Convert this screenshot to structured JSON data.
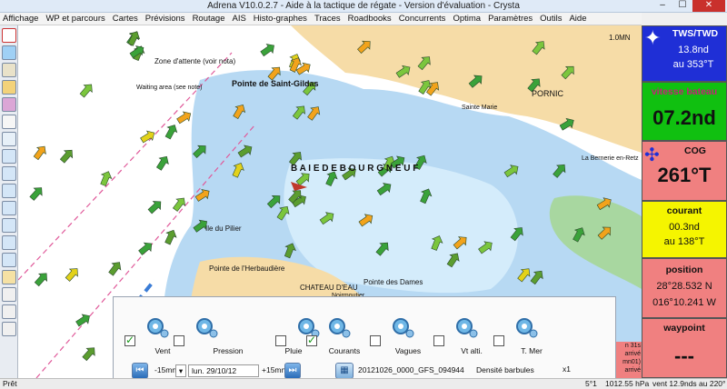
{
  "window": {
    "title": "Adrena V10.0.2.7 - Aide à la tactique de régate - Version d'évaluation - Crysta"
  },
  "menu": [
    "Affichage",
    "WP et parcours",
    "Cartes",
    "Prévisions",
    "Routage",
    "AIS",
    "Histo-graphes",
    "Traces",
    "Roadbooks",
    "Concurrents",
    "Optima",
    "Paramètres",
    "Outils",
    "Aide"
  ],
  "map": {
    "scale_label": "1.0MN",
    "labels": {
      "pointe_st_gildas": "Pointe de Saint-Gildas",
      "pornic": "PORNIC",
      "banc_bourgneuf": "B A I E   D E   B O U R G N E U F",
      "ile_pilier": "Ile du Pilier",
      "pointe_herbaudiere": "Pointe de l'Herbaudière",
      "chateau_eau": "CHATEAU D'EAU",
      "noirmoutier": "Noirmoutier",
      "pointe_dames": "Pointe des Dames",
      "zone_attente": "Zone d'attente (voir nota)",
      "waiting_area": "Waiting area (see note)",
      "la_bernerie": "La Bernerie en-Retz",
      "sainte_marie": "Sainte Marie"
    }
  },
  "panel": {
    "tws_label": "TWS/TWD",
    "tws_value": "13.8nd",
    "twd_value": "au 353°T",
    "speed_label": "vitesse bateau",
    "speed_value": "07.2nd",
    "cog_label": "COG",
    "cog_value": "261°T",
    "current_label": "courant",
    "current_speed": "00.3nd",
    "current_dir": "au 138°T",
    "position_label": "position",
    "lat": "28°28.532 N",
    "lon": "016°10.241 W",
    "waypoint_label": "waypoint",
    "waypoint_value": "---",
    "colors": {
      "tws": "#1f2fd6",
      "speed": "#10c010",
      "cog": "#f08080",
      "current": "#f5f500",
      "position": "#f08080",
      "waypoint": "#f08080"
    }
  },
  "layers": {
    "items": [
      {
        "name": "Vent",
        "checked": true
      },
      {
        "name": "Pression",
        "checked": false
      },
      {
        "name": "Pluie",
        "checked": false
      },
      {
        "name": "Courants",
        "checked": true
      },
      {
        "name": "Vagues",
        "checked": false
      },
      {
        "name": "Vt alti.",
        "checked": false
      },
      {
        "name": "T. Mer",
        "checked": false
      }
    ],
    "step_back": "-15mn",
    "date": "lun. 29/10/12 10h50",
    "step_fwd": "+15mn",
    "file": "20121026_0000_GFS_094944",
    "density_label": "Densité barbules :",
    "density_value": "x1"
  },
  "side_overlay": {
    "line1": "n 31s",
    "line2": "arrivé",
    "line3": "mn01)",
    "line4": "arrivé"
  },
  "status": {
    "ready": "Prêt",
    "pressure_prefix": "5°1",
    "pressure": "1012.55 hPa",
    "wind": "vent 12.9nds au 220°"
  }
}
